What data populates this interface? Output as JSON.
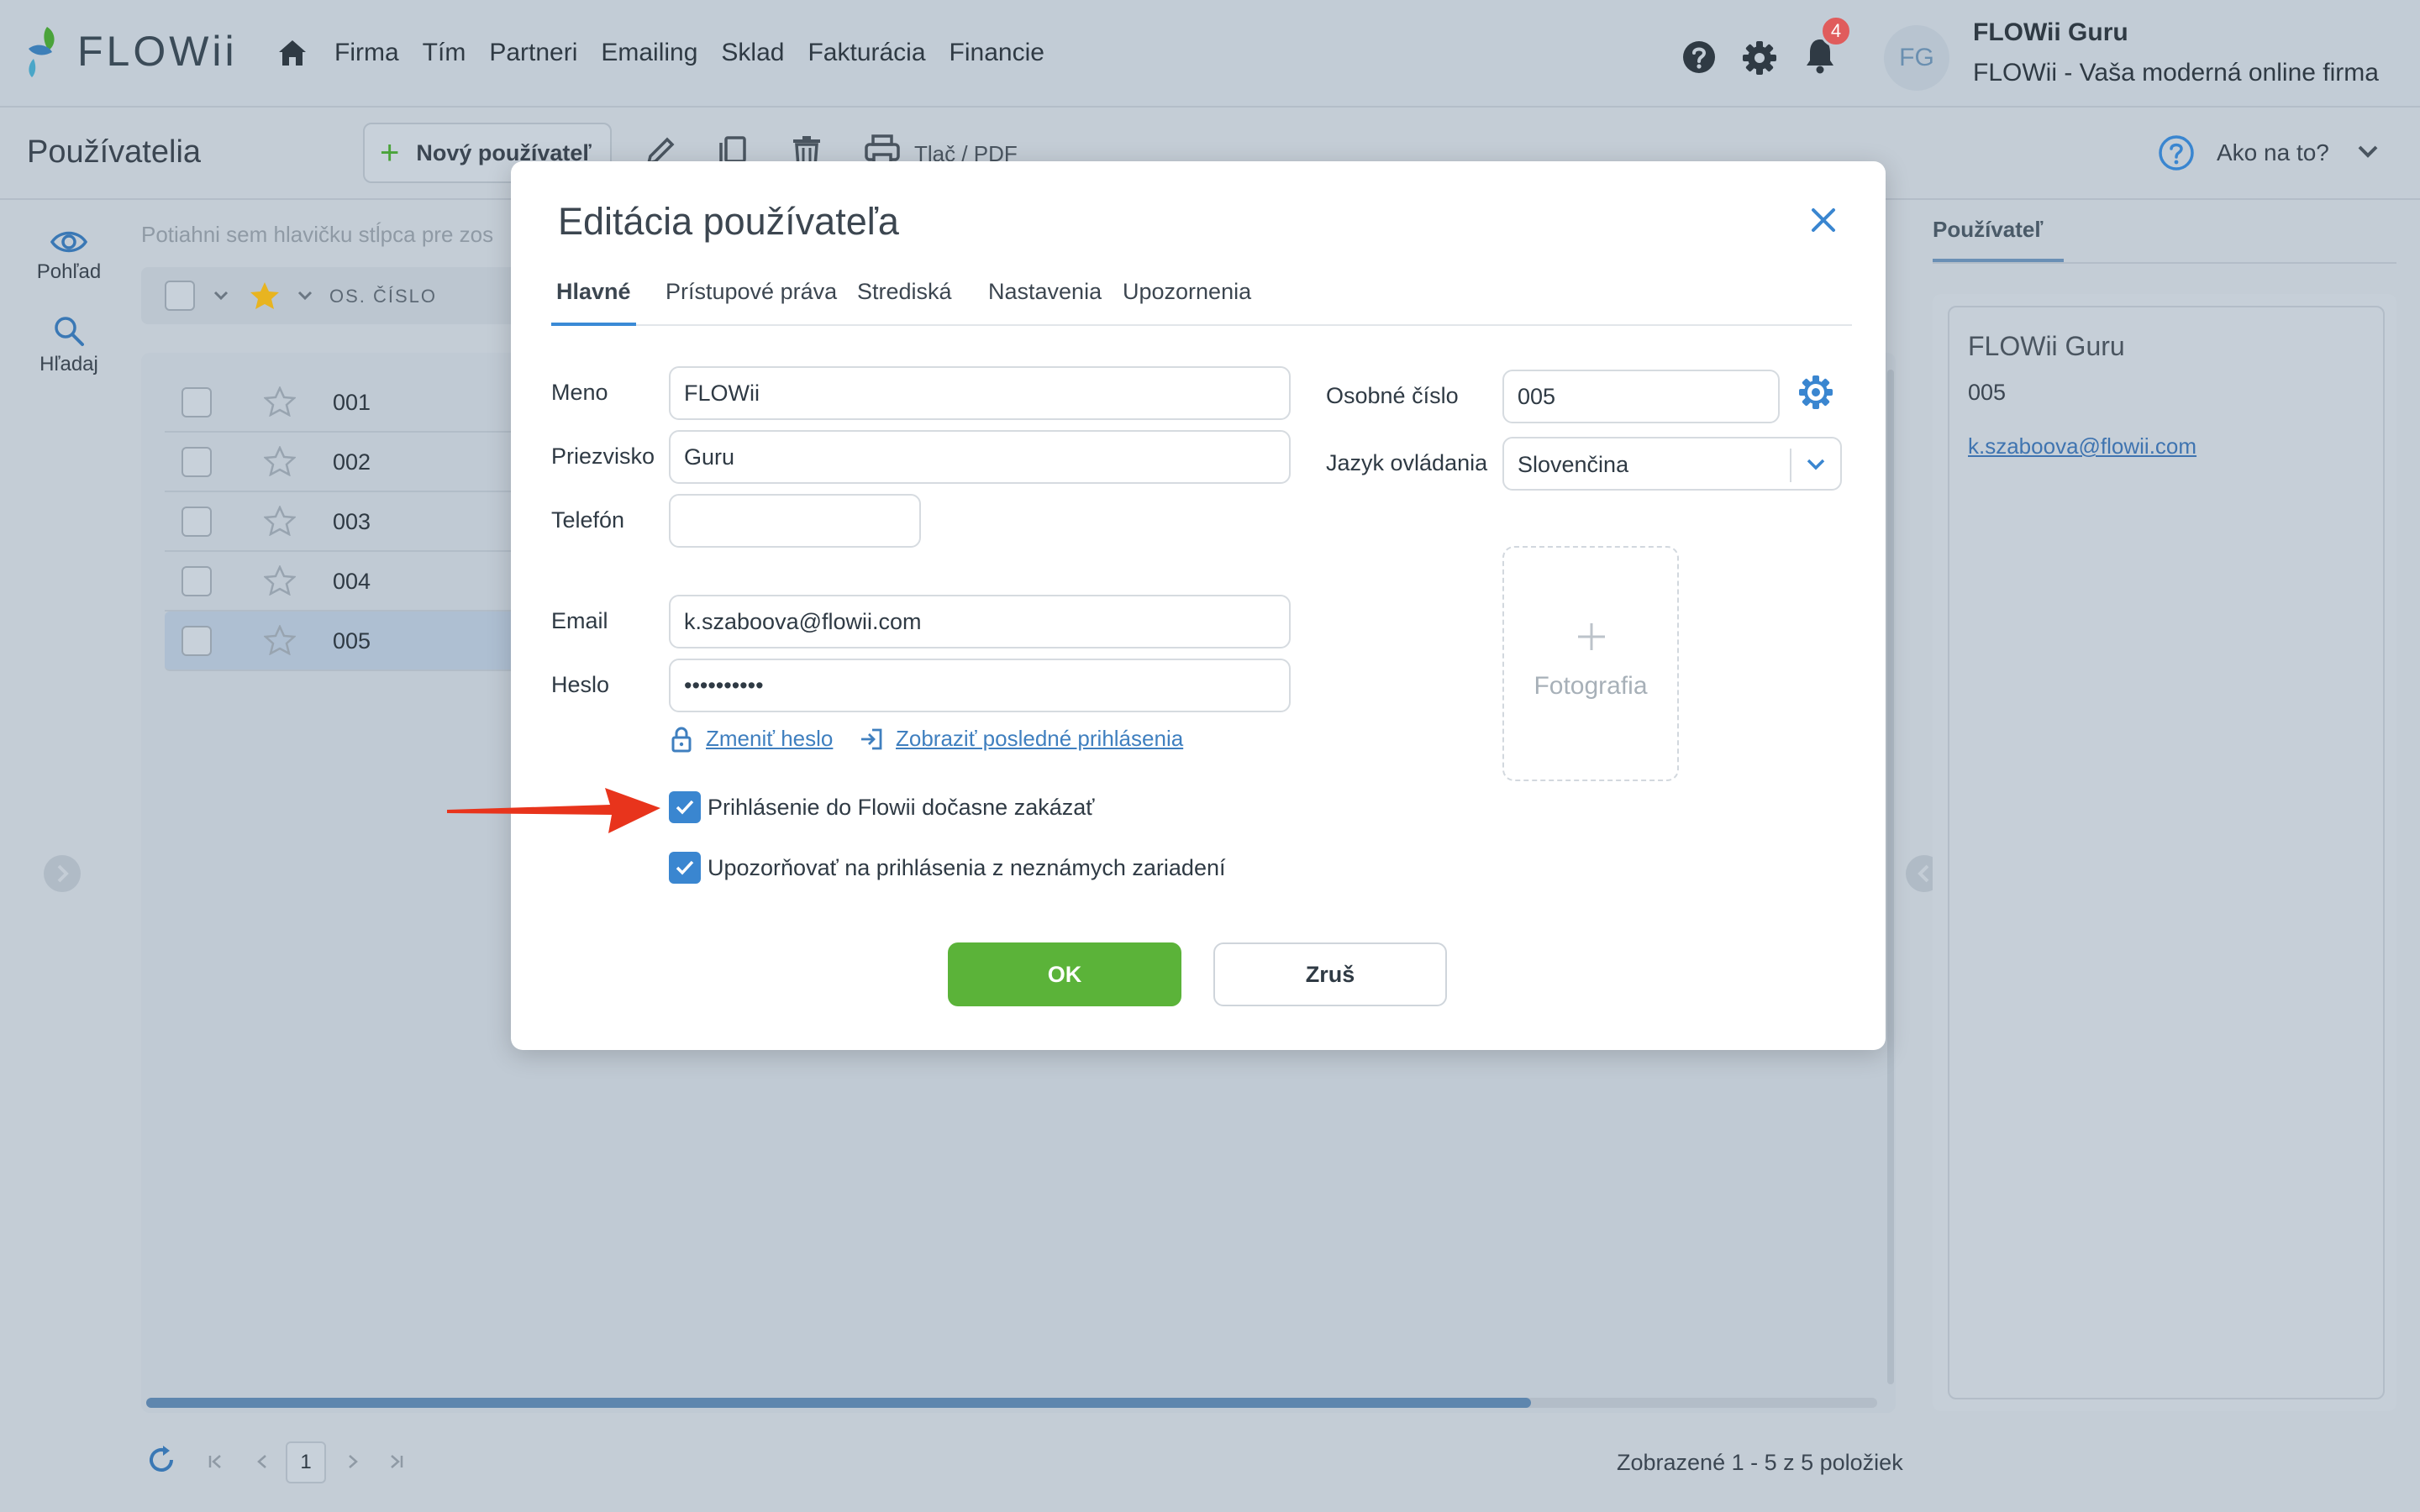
{
  "topbar": {
    "logo_text": "FLOWii",
    "nav": [
      "Firma",
      "Tím",
      "Partneri",
      "Emailing",
      "Sklad",
      "Fakturácia",
      "Financie"
    ],
    "notification_count": "4",
    "avatar_initials": "FG",
    "user_name": "FLOWii Guru",
    "user_company": "FLOWii - Vaša moderná online firma"
  },
  "toolbar": {
    "page_title": "Používatelia",
    "new_user_label": "Nový používateľ",
    "print_label": "Tlač / PDF",
    "howto_label": "Ako na to?"
  },
  "sidebar": {
    "view_label": "Pohľad",
    "search_label": "Hľadaj"
  },
  "grid": {
    "group_hint": "Potiahni sem hlavičku stĺpca pre zos",
    "column_header": "OS. ČÍSLO",
    "rows": [
      "001",
      "002",
      "003",
      "004",
      "005"
    ],
    "selected_row": "005",
    "current_page": "1",
    "pager_info": "Zobrazené 1 - 5 z 5 položiek",
    "h_scroll_fraction": 0.8
  },
  "right_panel": {
    "tab_label": "Používateľ",
    "name": "FLOWii Guru",
    "number": "005",
    "email": "k.szaboova@flowii.com"
  },
  "modal": {
    "title": "Editácia používateľa",
    "tabs": [
      "Hlavné",
      "Prístupové práva",
      "Strediská",
      "Nastavenia",
      "Upozornenia"
    ],
    "active_tab": "Hlavné",
    "labels": {
      "first_name": "Meno",
      "last_name": "Priezvisko",
      "phone": "Telefón",
      "email": "Email",
      "password": "Heslo",
      "personal_number": "Osobné číslo",
      "language": "Jazyk ovládania"
    },
    "values": {
      "first_name": "FLOWii",
      "last_name": "Guru",
      "phone": "",
      "email": "k.szaboova@flowii.com",
      "password": "••••••••••",
      "personal_number": "005",
      "language": "Slovenčina"
    },
    "photo_label": "Fotografia",
    "change_password_link": "Zmeniť heslo",
    "last_logins_link": "Zobraziť posledné prihlásenia",
    "checkbox_disable_login": "Prihlásenie do Flowii dočasne zakázať",
    "checkbox_notify_unknown": "Upozorňovať na prihlásenia z neznámych zariadení",
    "ok_label": "OK",
    "cancel_label": "Zruš"
  },
  "colors": {
    "accent_blue": "#3a86d0",
    "ok_green": "#5bb339",
    "annotation_red": "#e8341c",
    "badge_red": "#e05c5c"
  }
}
